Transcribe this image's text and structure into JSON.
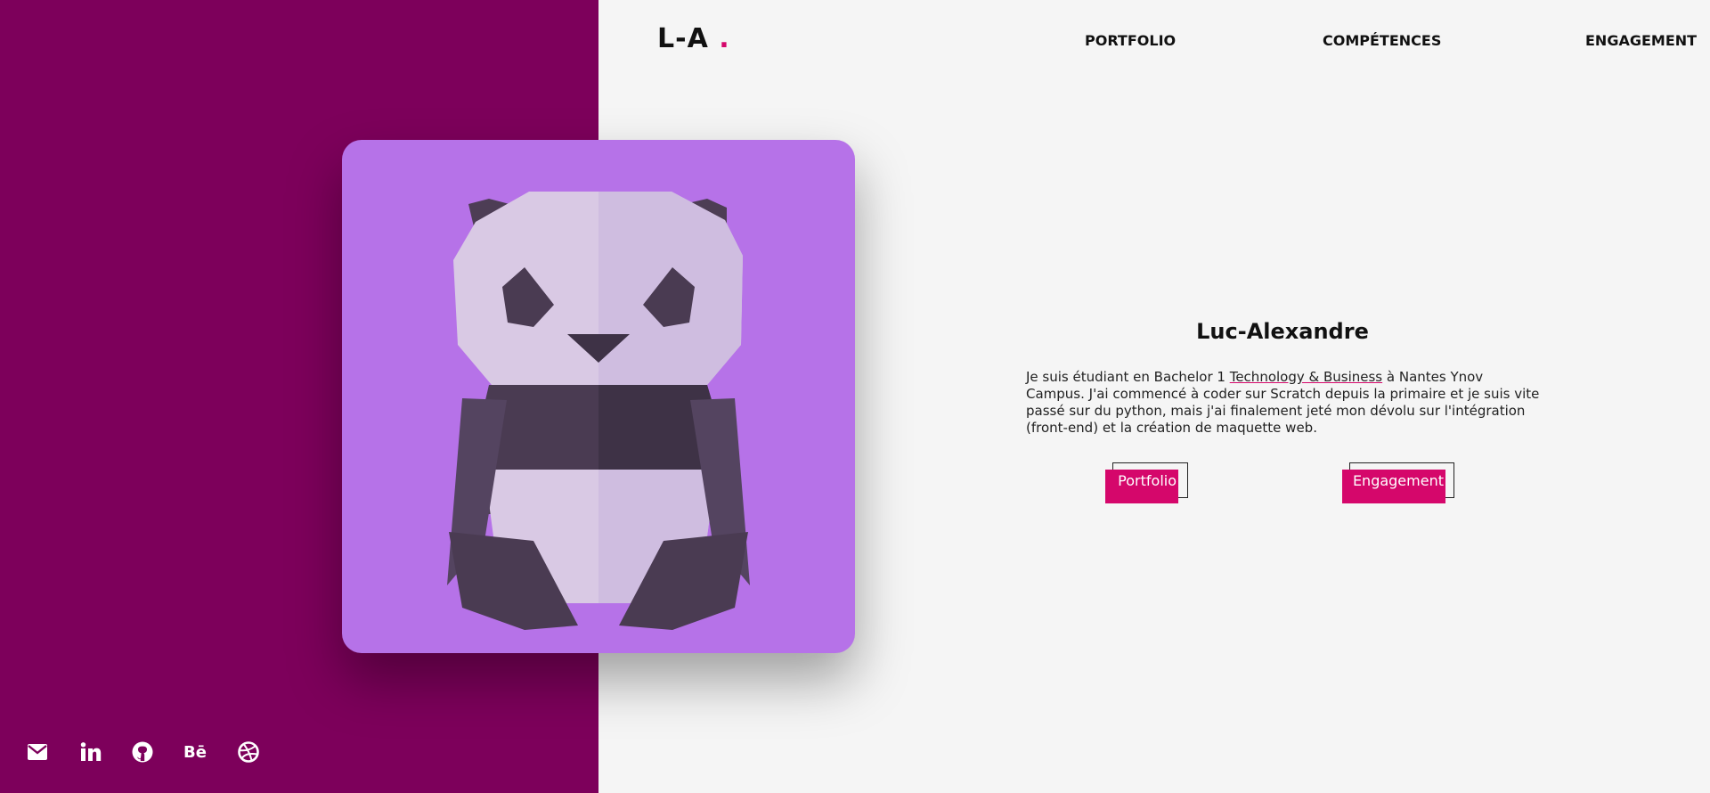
{
  "header": {
    "logo_text": "L-A",
    "logo_dot": ".",
    "nav": [
      "PORTFOLIO",
      "COMPÉTENCES",
      "ENGAGEMENT"
    ]
  },
  "hero": {
    "image_icon": "origami-panda-image",
    "name": "Luc-Alexandre",
    "bio_part1": "Je suis étudiant en Bachelor 1 ",
    "bio_link": "Technology & Business",
    "bio_part2": " à Nantes Ynov Campus. J'ai commencé à coder sur Scratch depuis la primaire et je suis vite passé sur du python, mais j'ai finalement jeté mon dévolu sur l'intégration (front-end) et la création de maquette web.",
    "buttons": [
      "Portfolio",
      "Engagement"
    ]
  },
  "social": {
    "icons": [
      "mail-icon",
      "linkedin-icon",
      "github-icon",
      "behance-icon",
      "dribbble-icon"
    ],
    "behance_label": "Bē"
  },
  "colors": {
    "accent": "#d5076b",
    "left_panel": "#7d005b",
    "card": "#b672e8",
    "background": "#f5f5f5"
  }
}
